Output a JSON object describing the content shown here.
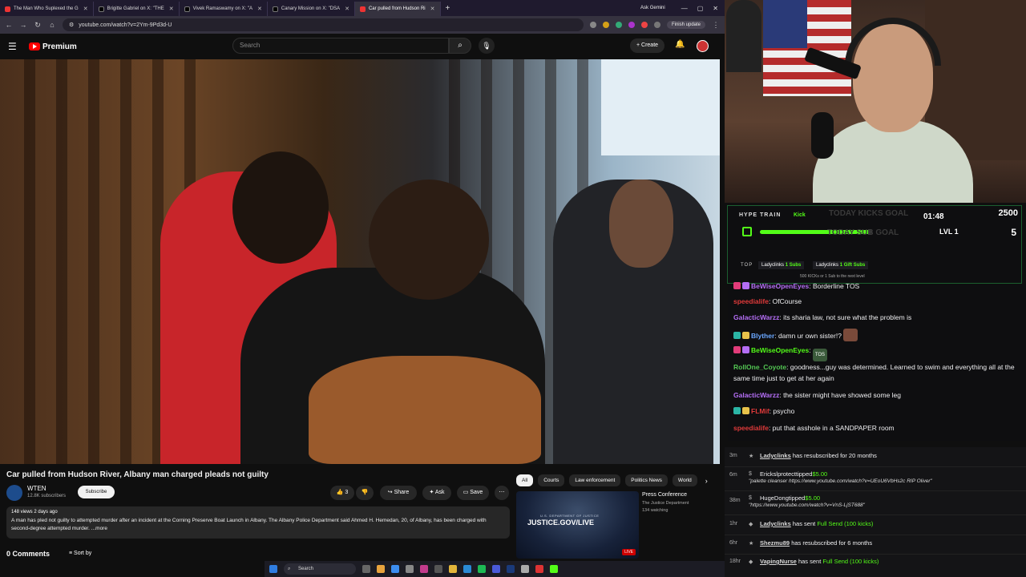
{
  "browser": {
    "tabs": [
      {
        "label": "The Man Who Suplexed the G"
      },
      {
        "label": "Brigitte Gabriel on X: \"THE"
      },
      {
        "label": "Vivek Ramaswamy on X: \"A"
      },
      {
        "label": "Canary Mission on X: \"DSA"
      },
      {
        "label": "Car pulled from Hudson Ri",
        "active": true
      }
    ],
    "ask_gemini": "Ask Gemini",
    "url": "youtube.com/watch?v=2Ym-9Pd3d-U",
    "finish_update": "Finish update"
  },
  "youtube": {
    "logo_text": "Premium",
    "search_placeholder": "Search",
    "create_label": "+ Create",
    "video": {
      "title": "Car pulled from Hudson River, Albany man charged pleads not guilty",
      "channel": "WTEN",
      "subscribers": "12.8K subscribers",
      "subscribe_label": "Subscribe",
      "likes": "3",
      "share_label": "Share",
      "ask_label": "Ask",
      "save_label": "Save",
      "views_date": "148 views  2 days ago",
      "description": "A man has pled not guilty to attempted murder after an incident at the Corning Preserve Boat Launch in Albany. The Albany Police Department said Ahmed H. Hemedan, 20, of Albany, has been charged with second-degree attempted murder.",
      "more_label": "...more",
      "comments_count": "0 Comments",
      "sort_by": "Sort by"
    },
    "chips": [
      "All",
      "Courts",
      "Law enforcement",
      "Politics News",
      "World"
    ],
    "recommended": {
      "thumb_text": "JUSTICE.GOV/LIVE",
      "thumb_small_text": "U.S. DEPARTMENT OF JUSTICE",
      "live_badge": "LIVE",
      "title": "Press Conference",
      "channel": "The Justice Department",
      "watching": "134 watching"
    }
  },
  "taskbar": {
    "search_label": "Search"
  },
  "stream": {
    "hype_train": {
      "label": "HYPE TRAIN",
      "platform": "Kick",
      "kicks_goal": "TODAY KICKS GOAL",
      "sub_goal": "TODAY SUB GOAL",
      "timer": "01:48",
      "score": "2500",
      "level_label": "LVL 1",
      "level_num": "5",
      "progress": 0.97,
      "top_label": "TOP",
      "top_entries": [
        {
          "user": "Ladyclinks",
          "value": "1 Subs"
        },
        {
          "user": "Ladyclinks",
          "value": "1 Gift Subs"
        }
      ],
      "next_level": "500 KICKs or 1 Sub to the next level"
    },
    "chat": [
      {
        "user": "BeWiseOpenEyes",
        "color": "#b46ef5",
        "text": "Borderline TOS"
      },
      {
        "user": "speedialife",
        "color": "#e03a3a",
        "text": "OfCourse"
      },
      {
        "user": "GalacticWarzz",
        "color": "#b46ef5",
        "text": "its sharia law, not sure what the problem is"
      },
      {
        "user": "Blyther",
        "color": "#6aa7ff",
        "text": "damn ur own sister!?"
      },
      {
        "user": "BeWiseOpenEyes",
        "color": "#b46ef5",
        "text": "",
        "emote": "TOS"
      },
      {
        "user": "RollOne_Coyote",
        "color": "#53c653",
        "text": "goodness...guy was determined. Learned to swim and everything all at the same time just to get at her again"
      },
      {
        "user": "GalacticWarzz",
        "color": "#b46ef5",
        "text": "the sister might have showed some leg"
      },
      {
        "user": "FLMif",
        "color": "#e03a3a",
        "text": "psycho"
      },
      {
        "user": "speedialife",
        "color": "#e03a3a",
        "text": "put that asshole in a SANDPAPER room"
      }
    ],
    "alerts": [
      {
        "time": "3m",
        "user": "Ladyclinks",
        "text": "has resubscribed for 20 months"
      },
      {
        "time": "6m",
        "user": "Erickslprotect",
        "text": "tipped",
        "amount": "$5.00",
        "sub": "\"palette cleanser https://www.youtube.com/watch?v=UEoU6VbHs2c RIP Oliver\""
      },
      {
        "time": "38m",
        "user": "HugeDongtipped",
        "text": "",
        "amount": "$5.00",
        "sub": "\"https://www.youtube.com/watch?v=VnS-LjST688\""
      },
      {
        "time": "1hr",
        "user": "Ladyclinks",
        "text": "has sent",
        "gift": "Full Send (100 kicks)"
      },
      {
        "time": "6hr",
        "user": "Shezmu89",
        "text": "has resubscribed for 6 months"
      },
      {
        "time": "18hr",
        "user": "VapingNurse",
        "text": "has sent",
        "gift": "Full Send (100 kicks)"
      }
    ]
  }
}
